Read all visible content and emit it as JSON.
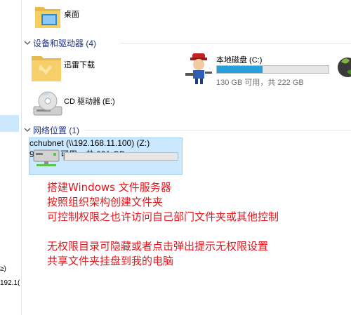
{
  "nav": {
    "fragments": [
      "≥)",
      "192.1("
    ]
  },
  "folders": {
    "desktop_label": "桌面"
  },
  "devices_group": {
    "header": "设备和驱动器 (4)",
    "items": [
      {
        "name": "迅雷下载"
      },
      {
        "name": "本地磁盘 (C:)",
        "usage_text": "130 GB 可用，共 222 GB",
        "used_fraction": 0.41
      },
      {
        "name": "CD 驱动器 (E:)"
      }
    ]
  },
  "network_group": {
    "header": "网络位置 (1)",
    "items": [
      {
        "name": "cchubnet (\\\\192.168.11.100) (Z:)",
        "usage_text": "930 GB 可用，共 931 GB",
        "used_fraction": 0.001
      }
    ]
  },
  "annotations": [
    "搭建Windows 文件服务器",
    "按照组织架构创建文件夹",
    "可控制权限之也许访问自己部门文件夹或其他控制",
    "",
    "无权限目录可隐藏或者点击弹出提示无权限设置",
    "共享文件夹挂盘到我的电脑"
  ],
  "colors": {
    "header_text": "#1e3287",
    "selection_bg": "#cce8ff",
    "drive_bar_fill": "#26a0da",
    "annotation_text": "#e4141b"
  }
}
